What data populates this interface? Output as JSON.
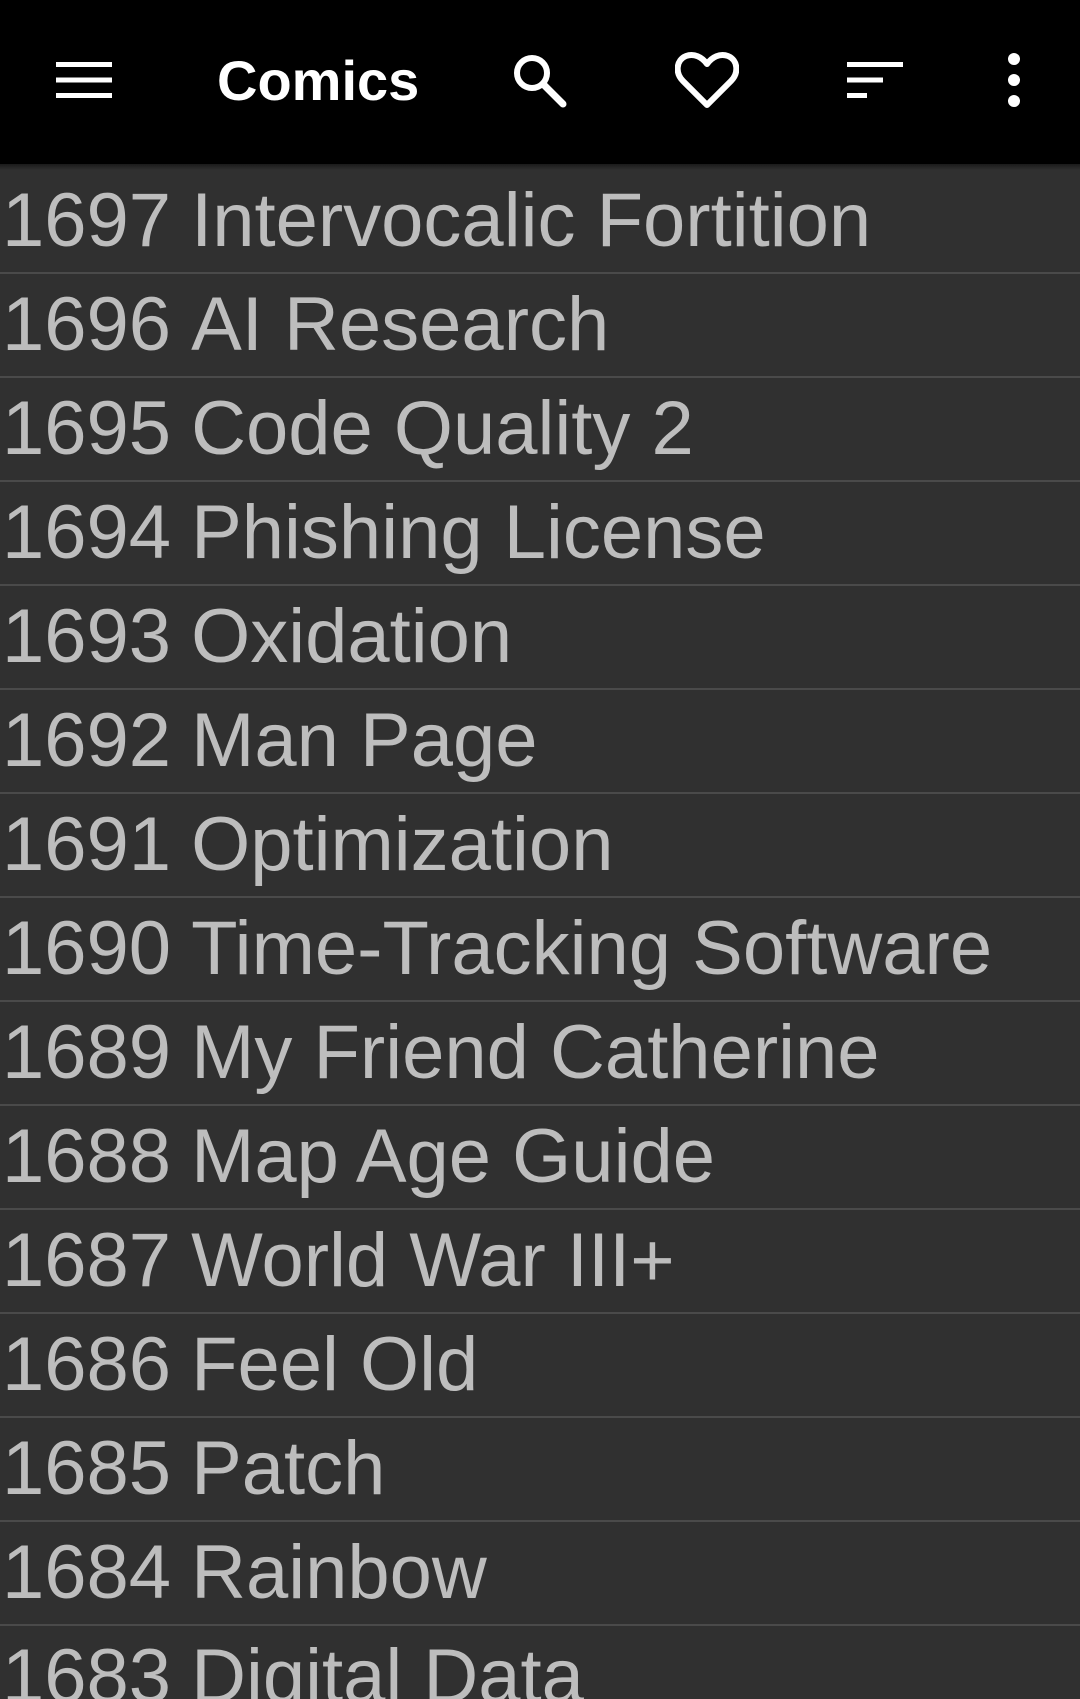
{
  "toolbar": {
    "title": "Comics",
    "icons": {
      "menu": "hamburger-menu-icon",
      "search": "search-icon",
      "favorites": "heart-outline-icon",
      "sort": "sort-icon",
      "overflow": "more-vert-icon"
    }
  },
  "comics": [
    {
      "num": "1697",
      "title": "Intervocalic Fortition"
    },
    {
      "num": "1696",
      "title": "AI Research"
    },
    {
      "num": "1695",
      "title": "Code Quality 2"
    },
    {
      "num": "1694",
      "title": "Phishing License"
    },
    {
      "num": "1693",
      "title": "Oxidation"
    },
    {
      "num": "1692",
      "title": "Man Page"
    },
    {
      "num": "1691",
      "title": "Optimization"
    },
    {
      "num": "1690",
      "title": "Time-Tracking Software"
    },
    {
      "num": "1689",
      "title": "My Friend Catherine"
    },
    {
      "num": "1688",
      "title": "Map Age Guide"
    },
    {
      "num": "1687",
      "title": "World War III+"
    },
    {
      "num": "1686",
      "title": "Feel Old"
    },
    {
      "num": "1685",
      "title": "Patch"
    },
    {
      "num": "1684",
      "title": "Rainbow"
    },
    {
      "num": "1683",
      "title": "Digital Data"
    }
  ],
  "colors": {
    "toolbar_bg": "#000000",
    "list_bg": "#303030",
    "row_text": "#bdbdbd",
    "divider": "#4a4a4a",
    "icon": "#ffffff"
  }
}
